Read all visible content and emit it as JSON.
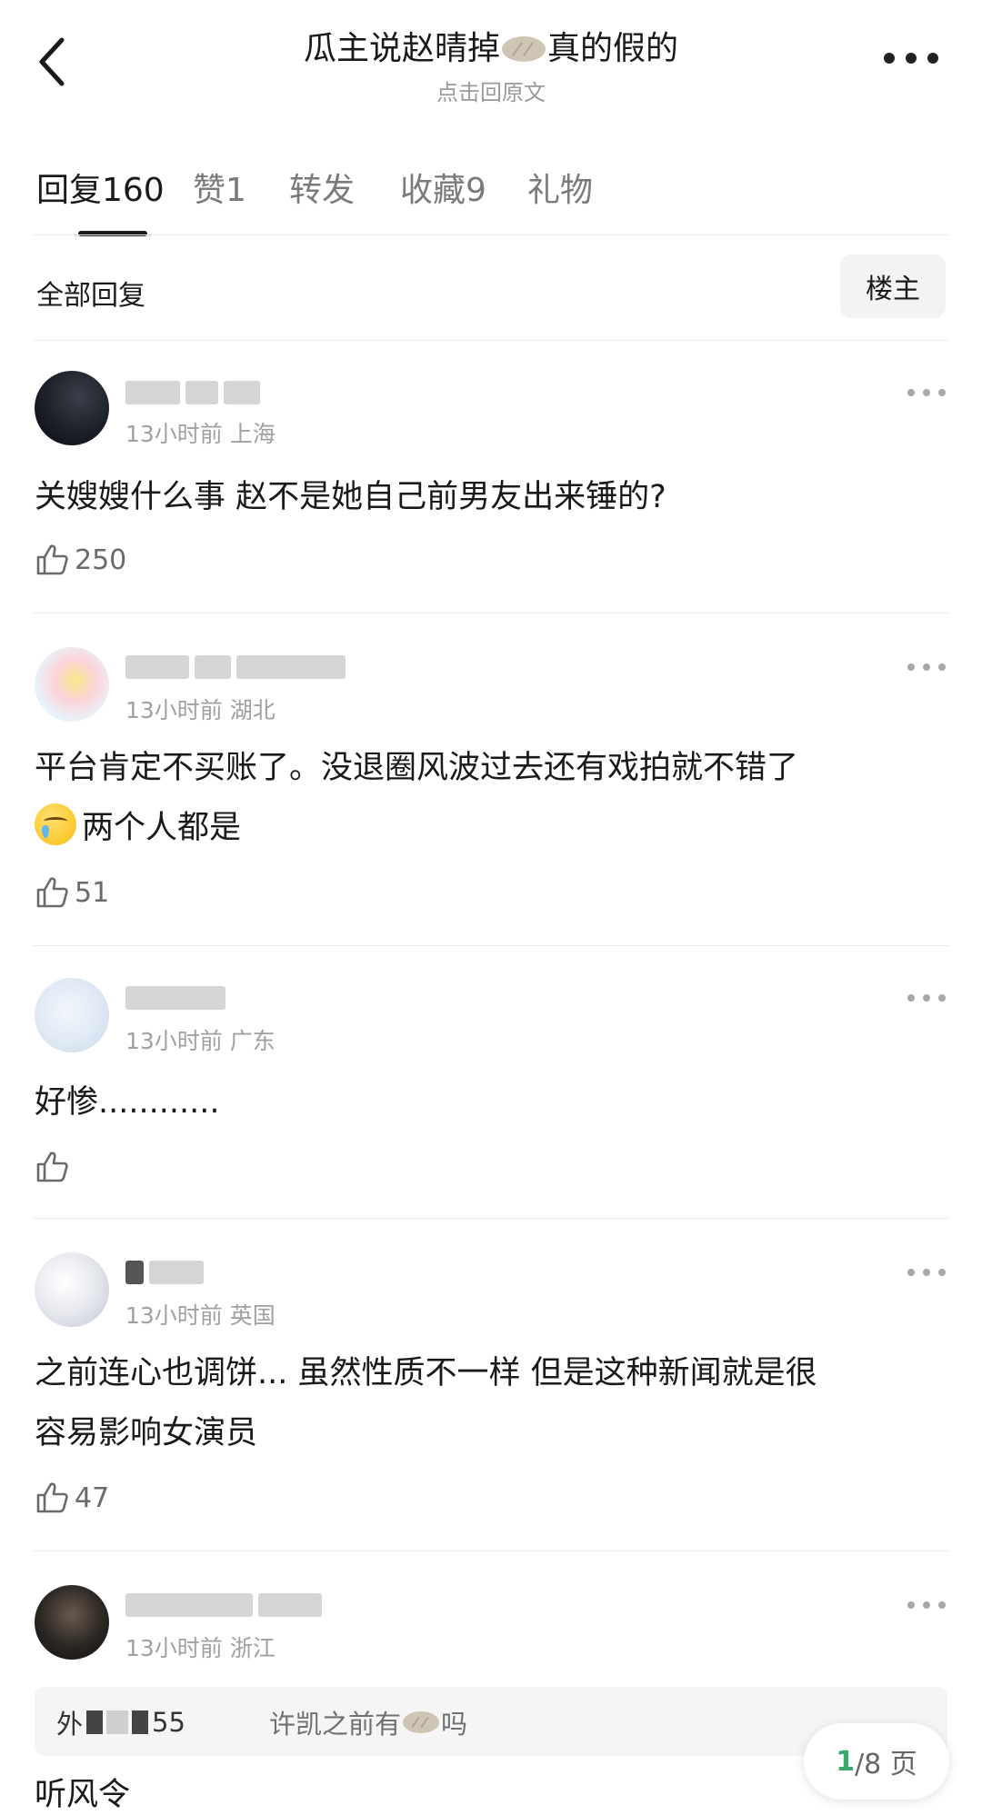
{
  "header": {
    "title_part1": "瓜主说赵晴掉",
    "title_icon": "bun-icon",
    "title_part2": "真的假的",
    "subtitle": "点击回原文",
    "back_icon": "chevron-left-icon",
    "more_icon": "more-horizontal-icon"
  },
  "tabs": [
    {
      "label": "回复160",
      "active": true
    },
    {
      "label": "赞1",
      "active": false
    },
    {
      "label": "转发",
      "active": false
    },
    {
      "label": "收藏9",
      "active": false
    },
    {
      "label": "礼物",
      "active": false
    }
  ],
  "filter": {
    "label": "全部回复",
    "owner_button": "楼主"
  },
  "comments": [
    {
      "time_location": "13小时前 上海",
      "text": "关嫂嫂什么事 赵不是她自己前男友出来锤的?",
      "likes": "250"
    },
    {
      "time_location": "13小时前 湖北",
      "text_line1": "平台肯定不买账了。没退圈风波过去还有戏拍就不错了",
      "text_line2": "两个人都是",
      "emoji": "crying-face-emoji",
      "likes": "51"
    },
    {
      "time_location": "13小时前 广东",
      "text": "好惨............",
      "likes": ""
    },
    {
      "time_location": "13小时前 英国",
      "text_line1": "之前连心也调饼... 虽然性质不一样 但是这种新闻就是很",
      "text_line2": "容易影响女演员",
      "likes": "47"
    },
    {
      "time_location": "13小时前 浙江",
      "quote_user_prefix": "外",
      "quote_user_suffix": "55",
      "quote_text_part1": "许凯之前有",
      "quote_text_part2": "吗",
      "text": "听风令"
    }
  ],
  "pagination": {
    "current": "1",
    "total": "/8 页"
  },
  "colors": {
    "accent_green": "#3aa76d",
    "text_primary": "#1a1a1a",
    "text_secondary": "#9a9a9a"
  }
}
